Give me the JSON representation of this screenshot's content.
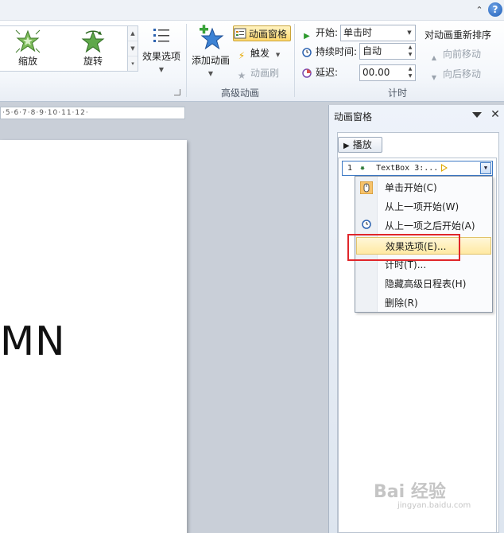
{
  "ribbon": {
    "gallery": {
      "items": [
        {
          "label": "缩放",
          "icon": "zoom-star-icon"
        },
        {
          "label": "旋转",
          "icon": "spin-star-icon"
        }
      ]
    },
    "effect_options_label": "效果选项",
    "add_animation_label": "添加动画",
    "animation_pane_label": "动画窗格",
    "trigger_label": "触发",
    "animation_painter_label": "动画刷",
    "advanced_group_label": "高级动画",
    "timing": {
      "start_label": "开始:",
      "start_value": "单击时",
      "duration_label": "持续时间:",
      "duration_value": "自动",
      "delay_label": "延迟:",
      "delay_value": "00.00",
      "group_label": "计时"
    },
    "reorder": {
      "title": "对动画重新排序",
      "move_earlier": "向前移动",
      "move_later": "向后移动"
    }
  },
  "ruler_text": "·5·6·7·8·9·10·11·12·",
  "slide": {
    "visible_text": "MN"
  },
  "pane": {
    "title": "动画窗格",
    "play_label": "播放",
    "item": {
      "number": "1",
      "label": "TextBox 3:..."
    }
  },
  "menu": {
    "items": [
      {
        "label": "单击开始(C)",
        "icon": "mouse-click-icon"
      },
      {
        "label": "从上一项开始(W)",
        "icon": ""
      },
      {
        "label": "从上一项之后开始(A)",
        "icon": "clock-icon"
      },
      {
        "label": "效果选项(E)...",
        "icon": ""
      },
      {
        "label": "计时(T)...",
        "icon": ""
      },
      {
        "label": "隐藏高级日程表(H)",
        "icon": ""
      },
      {
        "label": "删除(R)",
        "icon": ""
      }
    ],
    "highlighted_index": 3
  },
  "watermark": {
    "text": "Bai 经验",
    "sub": "jingyan.baidu.com"
  },
  "colors": {
    "highlight_box": "#e0262a",
    "ribbon_active": "#ffd86c",
    "pane_border": "#3b78c4"
  }
}
